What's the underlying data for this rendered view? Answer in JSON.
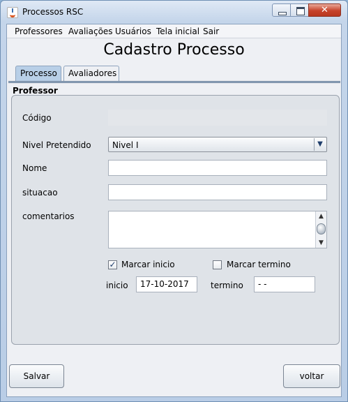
{
  "window": {
    "title": "Processos RSC"
  },
  "menubar": {
    "items": [
      "Professores",
      "Avaliações",
      "Usuários",
      "Tela inicial",
      "Sair"
    ]
  },
  "page": {
    "title": "Cadastro Processo"
  },
  "tabs": [
    "Processo",
    "Avaliadores"
  ],
  "form": {
    "section": "Professor",
    "codigo_label": "Código",
    "codigo_value": "",
    "nivel_label": "Nivel Pretendido",
    "nivel_value": "Nivel I",
    "nome_label": "Nome",
    "nome_value": "",
    "situacao_label": "situacao",
    "situacao_value": "",
    "comentarios_label": "comentarios",
    "comentarios_value": "",
    "marcar_inicio_label": "Marcar inicio",
    "marcar_inicio_checked": true,
    "marcar_termino_label": "Marcar termino",
    "marcar_termino_checked": false,
    "inicio_label": "inicio",
    "inicio_value": "17-10-2017",
    "termino_label": "termino",
    "termino_value": " - -"
  },
  "buttons": {
    "save": "Salvar",
    "back": "voltar"
  }
}
